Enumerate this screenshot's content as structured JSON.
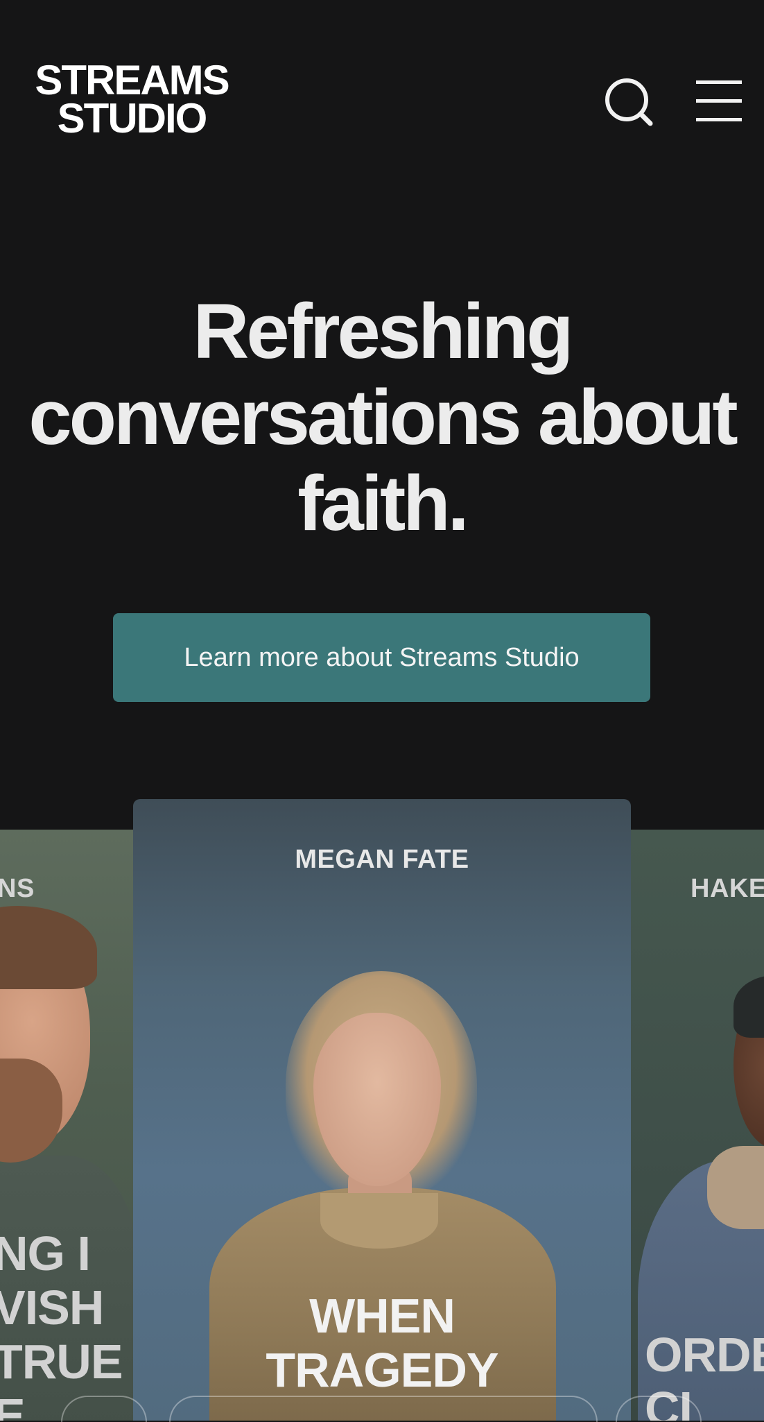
{
  "header": {
    "logo_line1": "STREAMS",
    "logo_line2": "STUDIO",
    "search_icon": "search-icon",
    "menu_icon": "hamburger-menu-icon"
  },
  "hero": {
    "headline_line1": "Refreshing",
    "headline_line2": "conversations about",
    "headline_line3": "faith.",
    "cta_label": "Learn more about Streams Studio"
  },
  "carousel": {
    "cards": [
      {
        "name": "NS",
        "title": [
          "NG I",
          "VISH",
          "TRUE",
          "E"
        ]
      },
      {
        "name": "MEGAN FATE",
        "title": [
          "WHEN",
          "TRAGEDY"
        ]
      },
      {
        "name": "HAKEI",
        "title": [
          "ORDE",
          "CI"
        ]
      }
    ]
  },
  "colors": {
    "background": "#151516",
    "accent": "#3b7779",
    "text": "#ececec"
  }
}
